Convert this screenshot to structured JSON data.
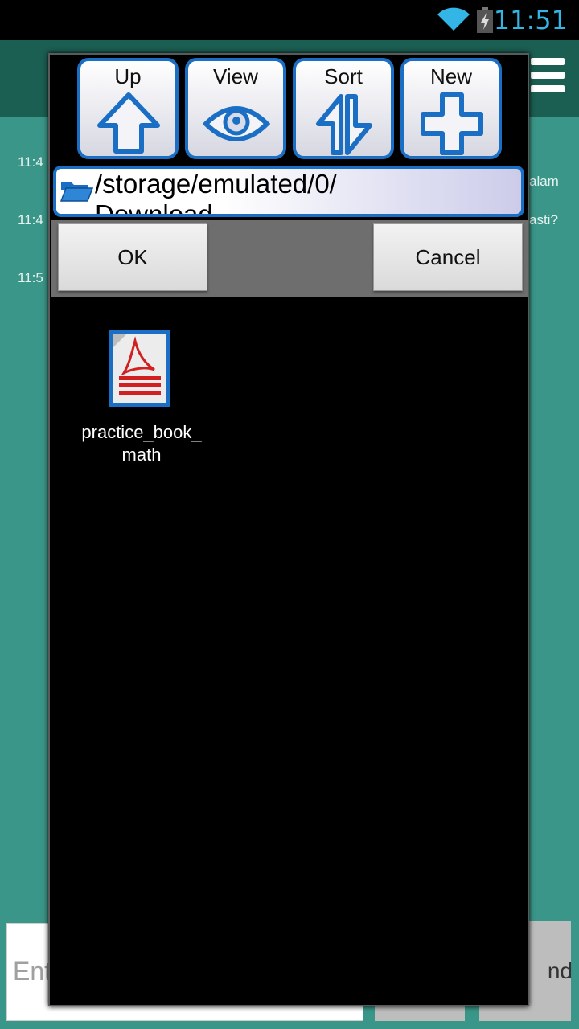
{
  "status_bar": {
    "time": "11:51"
  },
  "background": {
    "timestamps": [
      "11:4",
      "11:4",
      "11:5"
    ],
    "message_fragments": [
      "alam",
      "asti?"
    ],
    "input_placeholder": "Ent",
    "send_label": "nd"
  },
  "toolbar": {
    "up_label": "Up",
    "view_label": "View",
    "sort_label": "Sort",
    "new_label": "New"
  },
  "path": {
    "line1": "/storage/emulated/0/",
    "line2": "Download"
  },
  "actions": {
    "ok_label": "OK",
    "cancel_label": "Cancel"
  },
  "files": [
    {
      "name_line1": "practice_book_",
      "name_line2": "math",
      "type": "pdf-file-icon"
    }
  ],
  "colors": {
    "accent_blue": "#1a6fc4",
    "teal": "#3a9688",
    "status_time": "#33b5e5"
  }
}
